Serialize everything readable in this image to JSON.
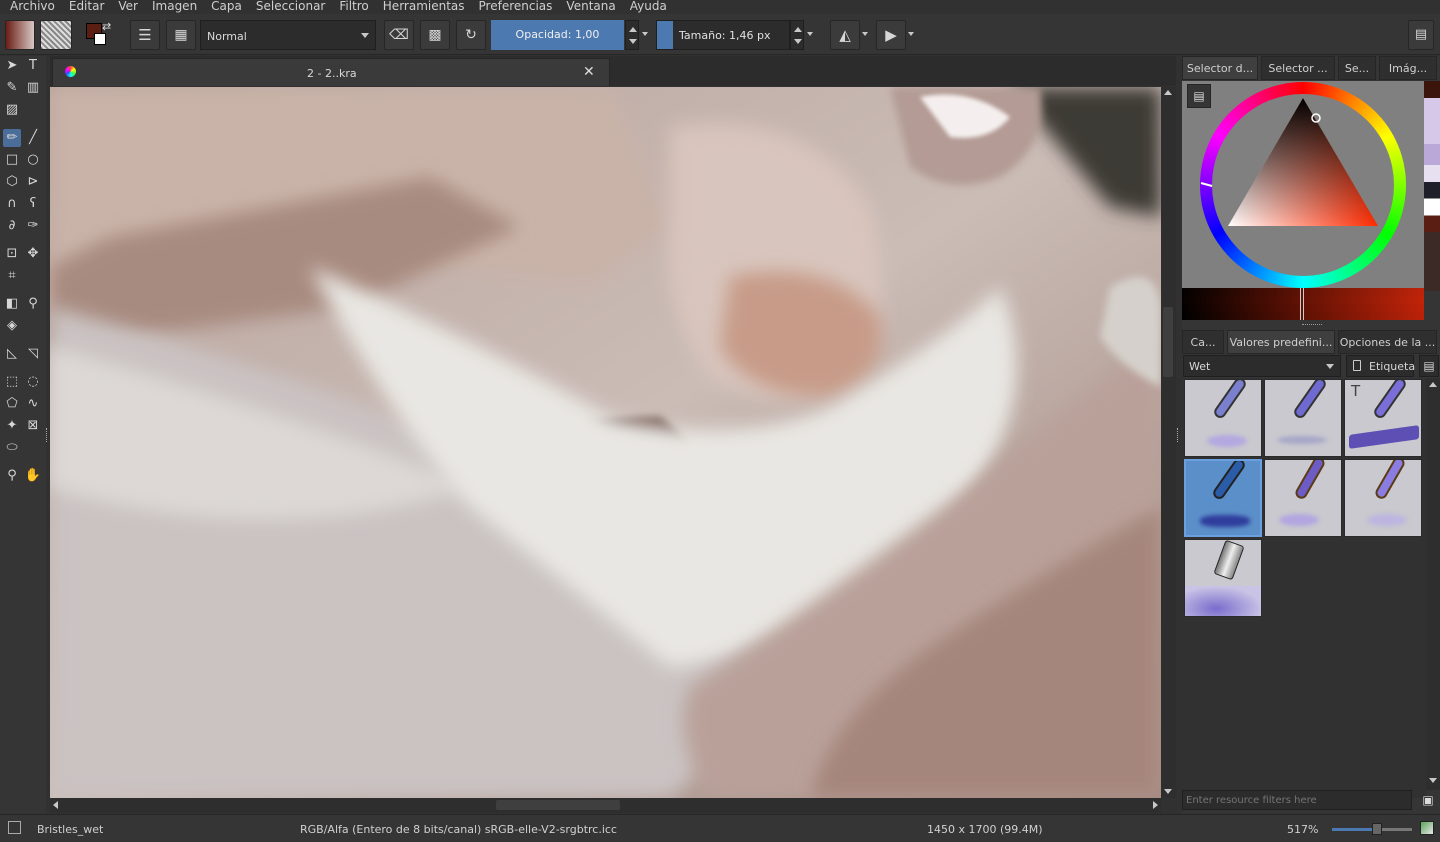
{
  "menu": [
    "Archivo",
    "Editar",
    "Ver",
    "Imagen",
    "Capa",
    "Seleccionar",
    "Filtro",
    "Herramientas",
    "Preferencias",
    "Ventana",
    "Ayuda"
  ],
  "toolbar": {
    "blend_mode": "Normal",
    "opacity_label": "Opacidad:  1,00",
    "size_label": "Tamaño:  1,46 px"
  },
  "document": {
    "tab_title": "2 - 2..kra"
  },
  "color_selector_tabs": [
    "Selector d...",
    "Selector ...",
    "Se...",
    "Imág..."
  ],
  "preset_tabs": [
    "Ca...",
    "Valores predefini...",
    "Opciones de la ..."
  ],
  "presets": {
    "tag_filter": "Wet",
    "tag_button": "Etiqueta",
    "filter_placeholder": "Enter resource filters here"
  },
  "status": {
    "brush_name": "Bristles_wet",
    "color_space": "RGB/Alfa (Entero de 8 bits/canal)  sRGB-elle-V2-srgbtrc.icc",
    "dimensions": "1450 x 1700 (99.4M)",
    "zoom": "517%"
  },
  "colors": {
    "accent": "#4c79b0",
    "foreground": "#5a1f12",
    "background_swatch": "#ffffff"
  }
}
